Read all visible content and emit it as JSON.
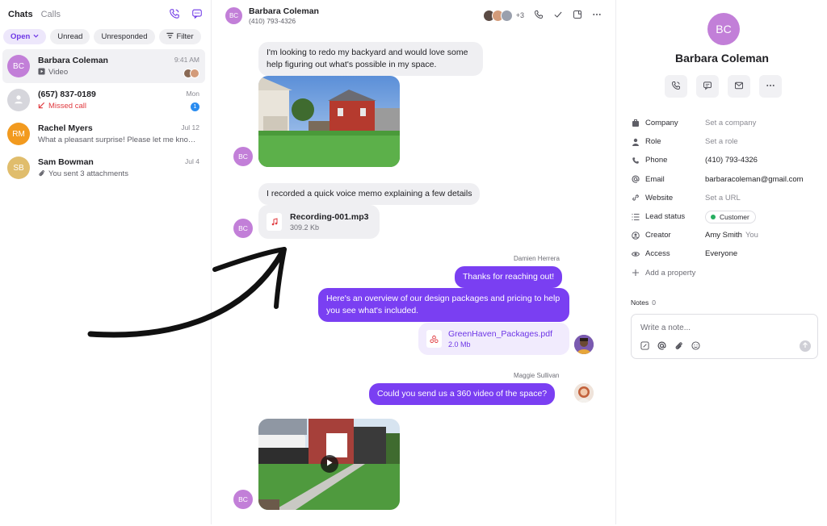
{
  "left": {
    "tabs": {
      "chats": "Chats",
      "calls": "Calls"
    },
    "filters": {
      "open": "Open",
      "unread": "Unread",
      "unresponded": "Unresponded",
      "filter": "Filter"
    },
    "chats": [
      {
        "initials": "BC",
        "name": "Barbara Coleman",
        "preview": "Video",
        "time": "9:41 AM",
        "color": "#c27fd8"
      },
      {
        "initials": "",
        "name": "(657) 837-0189",
        "preview": "Missed call",
        "time": "Mon",
        "badge": "1",
        "color": "#d6d6dc"
      },
      {
        "initials": "RM",
        "name": "Rachel Myers",
        "preview": "What a pleasant surprise! Please let me know if you...",
        "time": "Jul 12",
        "color": "#f29a1f"
      },
      {
        "initials": "SB",
        "name": "Sam Bowman",
        "preview": "You sent 3 attachments",
        "time": "Jul 4",
        "color": "#e0bd6c"
      }
    ]
  },
  "conversation": {
    "header": {
      "initials": "BC",
      "name": "Barbara Coleman",
      "phone": "(410) 793-4326",
      "extra_participants": "+3"
    },
    "messages": {
      "m1": "I'm looking to redo my backyard and would love some help figuring out what's possible in my space.",
      "m2": "I recorded a quick voice memo explaining a few details",
      "audio": {
        "name": "Recording-001.mp3",
        "size": "309.2 Kb"
      },
      "sender1": "Damien Herrera",
      "m3": "Thanks for reaching out!",
      "m4": "Here's an overview of our design packages and pricing to help you see what's included.",
      "pdf": {
        "name": "GreenHaven_Packages.pdf",
        "size": "2.0 Mb"
      },
      "sender2": "Maggie Sullivan",
      "m5": "Could you send us a 360 video of the space?",
      "contact_initials": "BC"
    }
  },
  "contact": {
    "initials": "BC",
    "name": "Barbara Coleman",
    "properties": [
      {
        "key": "Company",
        "value": "Set a company",
        "placeholder": true,
        "icon": "building-icon"
      },
      {
        "key": "Role",
        "value": "Set a role",
        "placeholder": true,
        "icon": "person-icon"
      },
      {
        "key": "Phone",
        "value": "(410) 793-4326",
        "placeholder": false,
        "icon": "phone-icon"
      },
      {
        "key": "Email",
        "value": "barbaracoleman@gmail.com",
        "placeholder": false,
        "icon": "at-icon"
      },
      {
        "key": "Website",
        "value": "Set a URL",
        "placeholder": true,
        "icon": "link-icon"
      },
      {
        "key": "Lead status",
        "value": "Customer",
        "placeholder": false,
        "icon": "list-icon"
      },
      {
        "key": "Creator",
        "value": "Amy Smith",
        "value_suffix": "You",
        "placeholder": false,
        "icon": "user-circle-icon"
      },
      {
        "key": "Access",
        "value": "Everyone",
        "placeholder": false,
        "icon": "eye-icon"
      }
    ],
    "add_property": "Add a property",
    "notes_label": "Notes",
    "notes_count": "0",
    "note_placeholder": "Write a note..."
  },
  "colors": {
    "accent": "#7a3ff2",
    "contact_avatar": "#c27fd8",
    "missed": "#e0393e",
    "status_green": "#27ae60"
  }
}
